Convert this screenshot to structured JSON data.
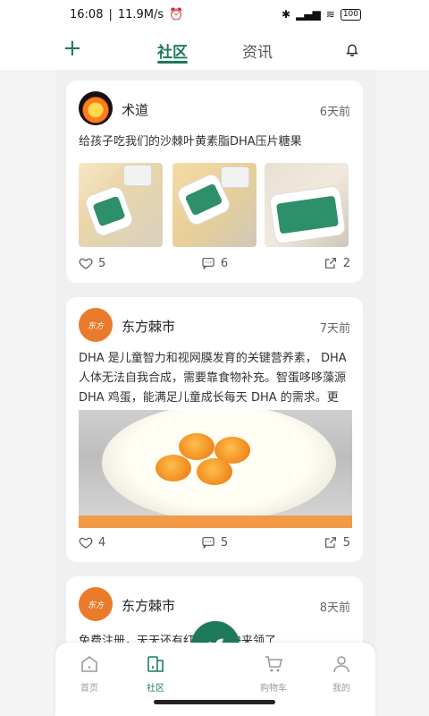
{
  "status_bar": {
    "time": "16:08",
    "network_speed": "11.9M/s",
    "battery": "100"
  },
  "header": {
    "tab_active": "社区",
    "tab_inactive": "资讯"
  },
  "posts": [
    {
      "author": "术道",
      "time": "6天前",
      "text": "给孩子吃我们的沙棘叶黄素脂DHA压片糖果",
      "likes": "5",
      "comments": "6",
      "shares": "2"
    },
    {
      "author": "东方棘市",
      "time": "7天前",
      "text": "DHA 是儿童智力和视网膜发育的关键营养素， DHA 人体无法自我合成，需要靠食物补充。智蛋哆哆藻源 DHA 鸡蛋，能满足儿童成长每天 DHA 的需求。更是…",
      "likes": "4",
      "comments": "5",
      "shares": "5"
    },
    {
      "author": "东方棘市",
      "time": "8天前",
      "text": "免费注册，天天还有红包领，快来领了……"
    }
  ],
  "bottom_nav": {
    "home": "首页",
    "community": "社区",
    "cart": "购物车",
    "mine": "我的"
  },
  "colors": {
    "accent": "#1f7a5c",
    "brand_orange": "#ea7b2c"
  },
  "icons": {
    "top_left": "plus-icon",
    "top_right": "bell-icon",
    "fab": "sprout-icon"
  }
}
